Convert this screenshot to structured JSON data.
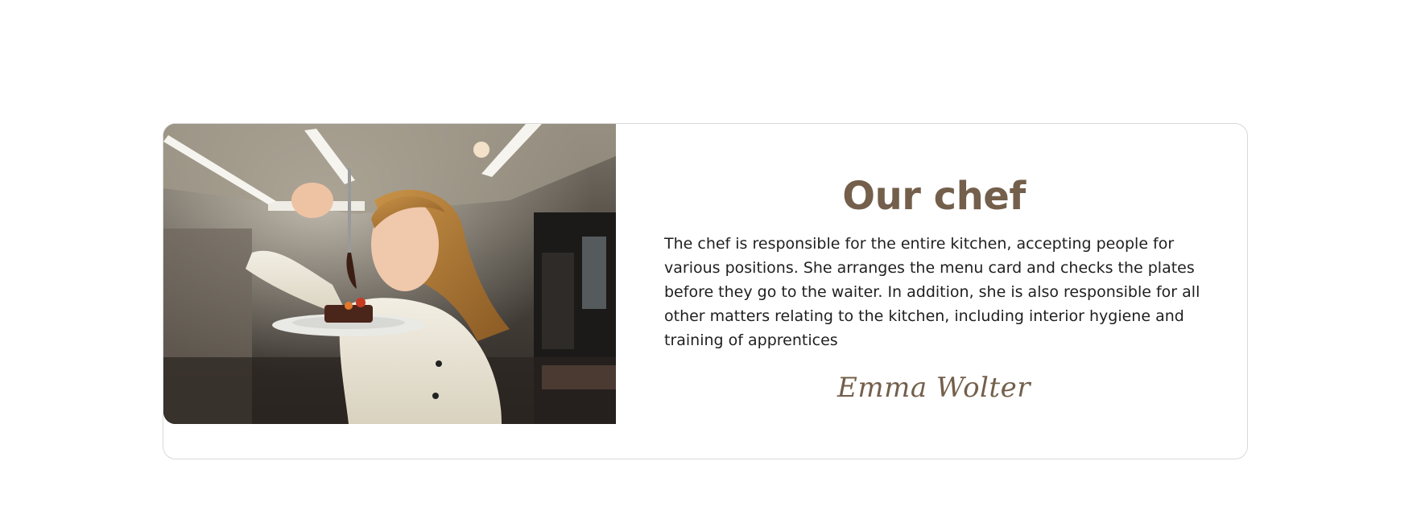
{
  "section": {
    "title": "Our chef",
    "description": "The chef is responsible for the entire kitchen, accepting people for various positions. She arranges the menu card and checks the plates before they go to the waiter. In addition, she is also responsible for all other matters relating to the kitchen, including interior hygiene and training of apprentices",
    "signature": "Emma Wolter",
    "photo_icon": "chef-photo",
    "colors": {
      "accent": "#735f4b",
      "text": "#1f1f1f",
      "border": "#d9d9d9",
      "background": "#ffffff"
    }
  }
}
